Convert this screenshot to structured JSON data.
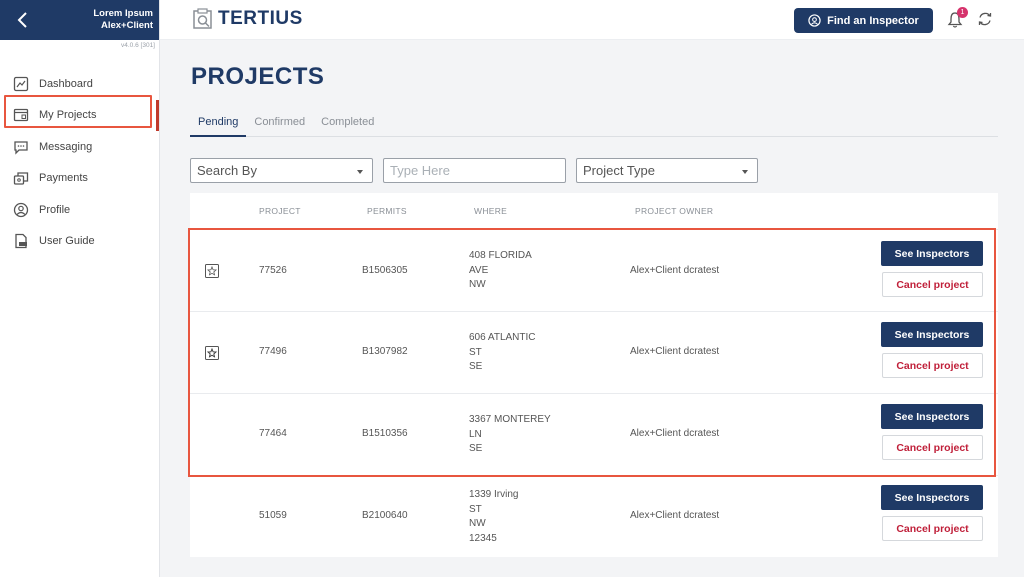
{
  "sidebar": {
    "user_line1": "Lorem Ipsum",
    "user_line2": "Alex+Client",
    "version": "v4.0.6 [301]",
    "items": [
      {
        "label": "Dashboard",
        "icon": "dashboard-icon"
      },
      {
        "label": "My Projects",
        "icon": "projects-icon"
      },
      {
        "label": "Messaging",
        "icon": "chat-icon"
      },
      {
        "label": "Payments",
        "icon": "payments-icon"
      },
      {
        "label": "Profile",
        "icon": "profile-icon"
      },
      {
        "label": "User Guide",
        "icon": "pdf-icon"
      }
    ]
  },
  "header": {
    "logo_text": "TERTIUS",
    "find_button": "Find an Inspector",
    "notification_count": "1"
  },
  "page": {
    "title": "PROJECTS",
    "tabs": [
      "Pending",
      "Confirmed",
      "Completed"
    ]
  },
  "filters": {
    "search_by": "Search By",
    "search_placeholder": "Type Here",
    "project_type": "Project Type"
  },
  "table": {
    "columns": [
      "PROJECT",
      "PERMITS",
      "WHERE",
      "PROJECT OWNER"
    ],
    "see_label": "See Inspectors",
    "cancel_label": "Cancel project",
    "rows": [
      {
        "project": "77526",
        "permit": "B1506305",
        "where": [
          "408 FLORIDA",
          "AVE",
          "NW"
        ],
        "owner": "Alex+Client dcratest"
      },
      {
        "project": "77496",
        "permit": "B1307982",
        "where": [
          "606 ATLANTIC",
          "ST",
          "SE"
        ],
        "owner": "Alex+Client dcratest"
      },
      {
        "project": "77464",
        "permit": "B1510356",
        "where": [
          "3367 MONTEREY",
          "LN",
          "SE"
        ],
        "owner": "Alex+Client dcratest"
      },
      {
        "project": "51059",
        "permit": "B2100640",
        "where": [
          "1339 Irving",
          "ST",
          "NW",
          "12345"
        ],
        "owner": "Alex+Client dcratest"
      }
    ]
  },
  "colors": {
    "brand": "#1f3a66",
    "danger": "#c0203a",
    "highlight": "#e8563f",
    "badge": "#d6336c"
  }
}
